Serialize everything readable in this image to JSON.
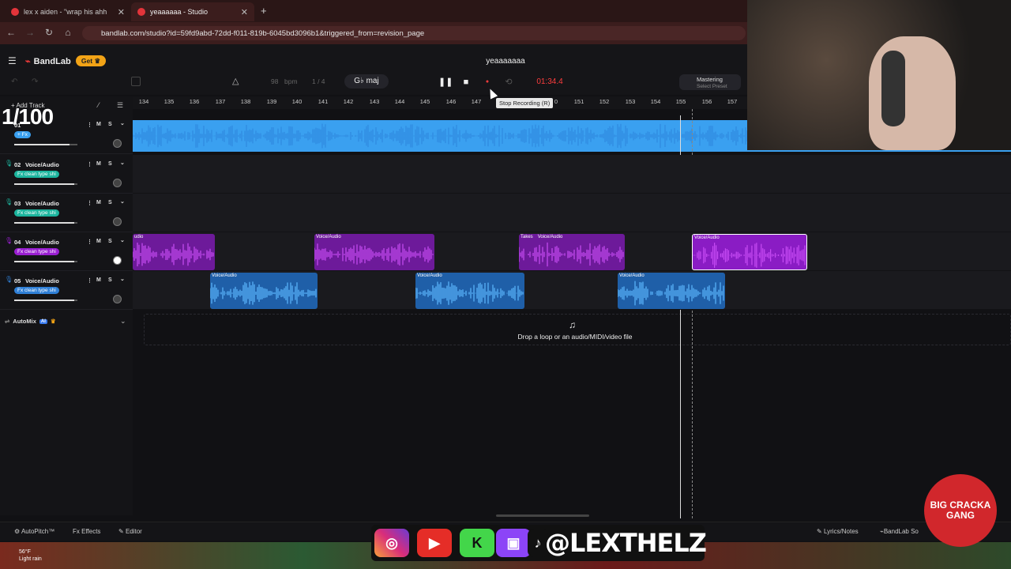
{
  "browser": {
    "tabs": [
      {
        "label": "lex x aiden - \"wrap his ahh"
      },
      {
        "label": "yeaaaaaa - Studio"
      }
    ],
    "new_tab": "+",
    "url": "bandlab.com/studio?id=59fd9abd-72dd-f011-819b-6045bd3096b1&triggered_from=revision_page"
  },
  "app": {
    "brand": "BandLab",
    "get_label": "Get",
    "song_title": "yeaaaaaaa",
    "tempo_value": "98",
    "tempo_unit": "bpm",
    "time_signature": "1 / 4",
    "key": "G♭ maj",
    "timecode": "01:34.4",
    "tooltip": "Stop Recording (R)",
    "mastering_label": "Mastering",
    "mastering_sub": "Select Preset",
    "add_track": "Add Track",
    "counter_overlay": "1/100"
  },
  "ruler": {
    "ticks": [
      "134",
      "135",
      "136",
      "137",
      "138",
      "139",
      "140",
      "141",
      "142",
      "143",
      "144",
      "145",
      "146",
      "147",
      "0",
      "151",
      "152",
      "153",
      "154",
      "155",
      "156",
      "157"
    ]
  },
  "tracks": [
    {
      "num": "01",
      "name": "",
      "fx": "+ Fx",
      "fx_color": "#3aa0f0",
      "mute": "M",
      "solo": "S"
    },
    {
      "num": "02",
      "name": "Voice/Audio",
      "fx": "Fx clean type shi",
      "fx_color": "#1cb59e",
      "mute": "M",
      "solo": "S"
    },
    {
      "num": "03",
      "name": "Voice/Audio",
      "fx": "Fx clean type shi",
      "fx_color": "#1cb59e",
      "mute": "M",
      "solo": "S"
    },
    {
      "num": "04",
      "name": "Voice/Audio",
      "fx": "Fx clean type shi",
      "fx_color": "#9a1fd2",
      "mute": "M",
      "solo": "S"
    },
    {
      "num": "05",
      "name": "Voice/Audio",
      "fx": "Fx clean type shi",
      "fx_color": "#2f7fd6",
      "mute": "M",
      "solo": "S"
    }
  ],
  "clips": {
    "purple": [
      {
        "label": "udio"
      },
      {
        "label": "Voice/Audio"
      },
      {
        "label": "Voice/Audio",
        "takes": "Takes"
      },
      {
        "label": "Voice/Audio"
      }
    ],
    "blue": [
      {
        "label": "Voice/Audio"
      },
      {
        "label": "Voice/Audio"
      },
      {
        "label": "Voice/Audio"
      }
    ]
  },
  "automix": {
    "label": "AutoMix",
    "badge": "AI"
  },
  "dropzone": {
    "text": "Drop a loop or an audio/MIDI/video file"
  },
  "footer": {
    "autopitch": "AutoPitch™",
    "effects": "Effects",
    "editor": "Editor",
    "lyrics": "Lyrics/Notes",
    "bandlab_sounds": "BandLab So"
  },
  "overlay": {
    "handle": "@LEXTHELZ",
    "mascot_text": "BIG CRACKA GANG"
  },
  "taskbar": {
    "temp": "56°F",
    "weather": "Light rain"
  },
  "colors": {
    "accent_red": "#f23b3b",
    "get_orange": "#f2a316",
    "track1_blue": "#3aa0f0",
    "clip_purple": "#9a1fd2",
    "clip_blue": "#2f7fd6"
  }
}
